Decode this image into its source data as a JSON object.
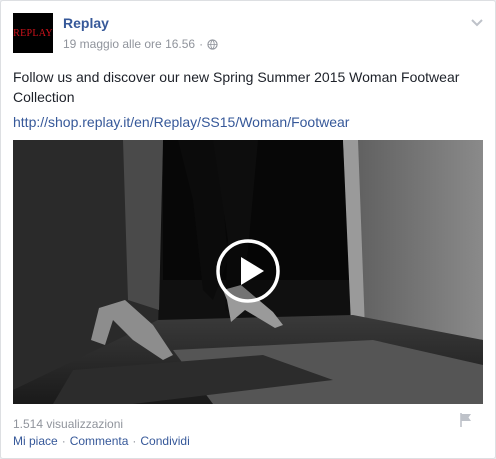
{
  "post": {
    "page_name": "Replay",
    "logo_text": "REPLAY",
    "timestamp": "19 maggio alle ore 16.56",
    "separator": "·",
    "text": "Follow us and discover our new Spring Summer 2015 Woman Footwear Collection",
    "link": "http://shop.replay.it/en/Replay/SS15/Woman/Footwear",
    "views": "1.514 visualizzazioni"
  },
  "actions": {
    "like": "Mi piace",
    "comment": "Commenta",
    "share": "Condividi",
    "separator": "·"
  },
  "icons": {
    "privacy": "globe-icon",
    "options": "chevron-down-icon",
    "video": "play-icon",
    "report": "flag-icon"
  },
  "colors": {
    "link": "#365899",
    "text": "#1d2129",
    "meta": "#90949c",
    "logo_bg": "#000000",
    "logo_text": "#d0121b"
  }
}
